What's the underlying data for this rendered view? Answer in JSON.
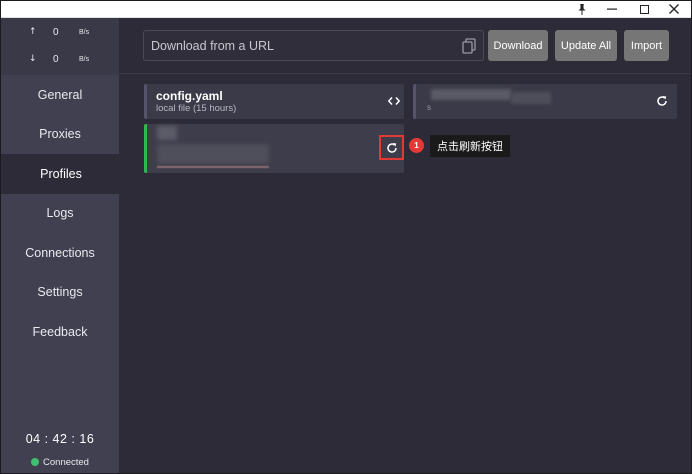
{
  "titlebar": {
    "pin_icon": "pin-icon",
    "minimize_icon": "minimize-icon",
    "maximize_icon": "maximize-icon",
    "close_icon": "close-icon"
  },
  "traffic": {
    "up_arrow": "↑",
    "up_value": "0",
    "up_unit": "B/s",
    "down_arrow": "↓",
    "down_value": "0",
    "down_unit": "B/s"
  },
  "nav": {
    "items": [
      {
        "label": "General"
      },
      {
        "label": "Proxies"
      },
      {
        "label": "Profiles",
        "active": true
      },
      {
        "label": "Logs"
      },
      {
        "label": "Connections"
      },
      {
        "label": "Settings"
      },
      {
        "label": "Feedback"
      }
    ]
  },
  "footer": {
    "clock": "04 : 42 : 16",
    "status": "Connected",
    "status_color": "#3fbf6f"
  },
  "header": {
    "url_placeholder": "Download from a URL",
    "download_label": "Download",
    "update_all_label": "Update All",
    "import_label": "Import",
    "button_color": "#767676"
  },
  "profiles": {
    "config": {
      "name": "config.yaml",
      "sub": "local file (15 hours)"
    },
    "remote": {
      "sub": "s"
    },
    "active_color": "#2fb84b"
  },
  "callout": {
    "number": "1",
    "label": "点击刷新按钮",
    "color": "#e53935"
  }
}
